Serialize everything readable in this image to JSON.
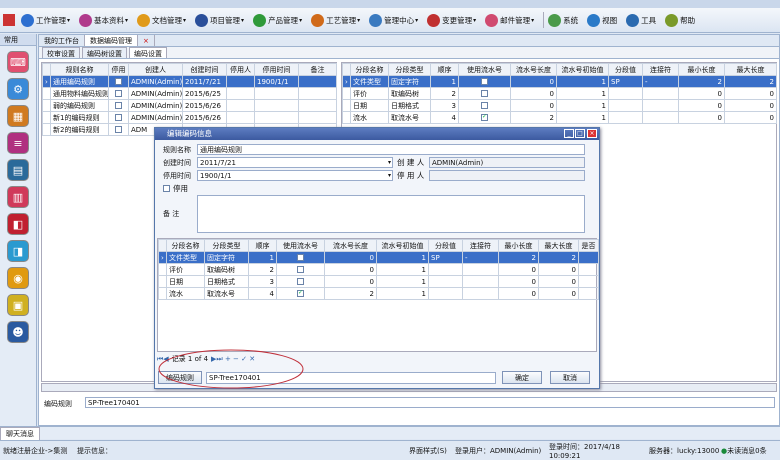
{
  "menu": [
    {
      "label": "工作管理",
      "color": "#2d6fd0"
    },
    {
      "label": "基本资料",
      "color": "#b03a8c"
    },
    {
      "label": "文档管理",
      "color": "#e09a1a"
    },
    {
      "label": "项目管理",
      "color": "#2a4f9a"
    },
    {
      "label": "产品管理",
      "color": "#2f9a3a"
    },
    {
      "label": "工艺管理",
      "color": "#d06a1a"
    },
    {
      "label": "管理中心",
      "color": "#3a7ac0"
    },
    {
      "label": "变更管理",
      "color": "#c03030"
    },
    {
      "label": "邮件管理",
      "color": "#d04a70"
    },
    {
      "label": "系统",
      "color": "#4a9a4a"
    },
    {
      "label": "视图",
      "color": "#2a7ac8"
    },
    {
      "label": "工具",
      "color": "#2a6ab0"
    },
    {
      "label": "帮助",
      "color": "#7a9a2a"
    }
  ],
  "sidebar": {
    "header": "常用",
    "icons": [
      {
        "name": "keyboard-icon",
        "color": "#e05070",
        "glyph": "⌨"
      },
      {
        "name": "network-icon",
        "color": "#3a8ad8",
        "glyph": "⚙"
      },
      {
        "name": "boxes-icon",
        "color": "#d07a20",
        "glyph": "▦"
      },
      {
        "name": "list-icon",
        "color": "#b03080",
        "glyph": "≡"
      },
      {
        "name": "chart-icon",
        "color": "#2a6a9a",
        "glyph": "▤"
      },
      {
        "name": "document-icon",
        "color": "#d03a5a",
        "glyph": "▥"
      },
      {
        "name": "briefcase-icon",
        "color": "#c02030",
        "glyph": "◧"
      },
      {
        "name": "phone-icon",
        "color": "#2a9ad0",
        "glyph": "◨"
      },
      {
        "name": "globe-icon",
        "color": "#e09a10",
        "glyph": "◉"
      },
      {
        "name": "id-card-icon",
        "color": "#d0b020",
        "glyph": "▣"
      },
      {
        "name": "person-icon",
        "color": "#2a5aa0",
        "glyph": "☻"
      }
    ]
  },
  "tabs": [
    {
      "label": "我的工作台"
    },
    {
      "label": "数据编码管理"
    }
  ],
  "subtabs": [
    {
      "label": "校审设置"
    },
    {
      "label": "编码树设置"
    },
    {
      "label": "编码设置"
    }
  ],
  "left_table": {
    "columns": [
      "规则名称",
      "停用",
      "创建人",
      "创建时间",
      "停用人",
      "停用时间",
      "备注"
    ],
    "rows": [
      [
        "通用编码规则",
        "",
        "ADMIN(Admin)",
        "2011/7/21",
        "",
        "1900/1/1",
        ""
      ],
      [
        "通用物料编码规则",
        "",
        "ADMIN(Admin)",
        "2015/6/25",
        "",
        "",
        ""
      ],
      [
        "弱的编码规则",
        "",
        "ADMIN(Admin)",
        "2015/6/26",
        "",
        "",
        ""
      ],
      [
        "新1的编码规则",
        "",
        "ADMIN(Admin)",
        "2015/6/26",
        "",
        "",
        ""
      ],
      [
        "新2的编码规则",
        "",
        "ADM",
        "",
        "",
        "",
        ""
      ]
    ]
  },
  "right_table": {
    "columns": [
      "分段名称",
      "分段类型",
      "顺序",
      "使用流水号",
      "流水号长度",
      "流水号初始值",
      "分段值",
      "连接符",
      "最小长度",
      "最大长度"
    ],
    "rows": [
      [
        "文件类型",
        "固定字符",
        "1",
        "",
        "0",
        "1",
        "SP",
        "-",
        "2",
        "2"
      ],
      [
        "评价",
        "取编码树",
        "2",
        "",
        "0",
        "1",
        "",
        "",
        "0",
        "0"
      ],
      [
        "日期",
        "日期格式",
        "3",
        "",
        "0",
        "1",
        "",
        "",
        "0",
        "0"
      ],
      [
        "流水",
        "取流水号",
        "4",
        "✓",
        "2",
        "1",
        "",
        "",
        "0",
        "0"
      ]
    ]
  },
  "dialog": {
    "title": "编辑编码信息",
    "rule_name_label": "规则名称",
    "rule_name": "通用编码规则",
    "created_label": "创建时间",
    "created": "2011/7/21",
    "creator_label": "创 建 人",
    "creator": "ADMIN(Admin)",
    "disabled_time_label": "停用时间",
    "disabled_time": "1900/1/1",
    "disabled_by_label": "停 用 人",
    "disabled_by": "",
    "disable_label": "停用",
    "remark_label": "备 注",
    "columns": [
      "分段名称",
      "分段类型",
      "顺序",
      "使用流水号",
      "流水号长度",
      "流水号初始值",
      "分段值",
      "连接符",
      "最小长度",
      "最大长度",
      "是否"
    ],
    "rows": [
      [
        "文件类型",
        "固定字符",
        "1",
        "",
        "0",
        "1",
        "SP",
        "-",
        "2",
        "2",
        ""
      ],
      [
        "评价",
        "取编码树",
        "2",
        "",
        "0",
        "1",
        "",
        "",
        "0",
        "0",
        ""
      ],
      [
        "日期",
        "日期格式",
        "3",
        "",
        "0",
        "1",
        "",
        "",
        "0",
        "0",
        ""
      ],
      [
        "流水",
        "取流水号",
        "4",
        "✓",
        "2",
        "1",
        "",
        "",
        "0",
        "0",
        ""
      ]
    ],
    "record_nav": "记录 1 of 4",
    "code_rule_button": "编码规则",
    "code_rule_value": "SP-Tree170401",
    "ok_button": "确定",
    "cancel_button": "取消"
  },
  "bottom": {
    "label": "编码规则",
    "value": "SP-Tree170401"
  },
  "bottom_tab": "聊天消息",
  "status": {
    "left": "就绪注册企业->集测",
    "hint": "提示信息：",
    "style": "界面样式(S)",
    "user": "登录用户：ADMIN(Admin)",
    "login_time": "登录时间：2017/4/18 10:09:21",
    "server": "服务器：lucky:13000",
    "unread": "未读消息0条"
  }
}
